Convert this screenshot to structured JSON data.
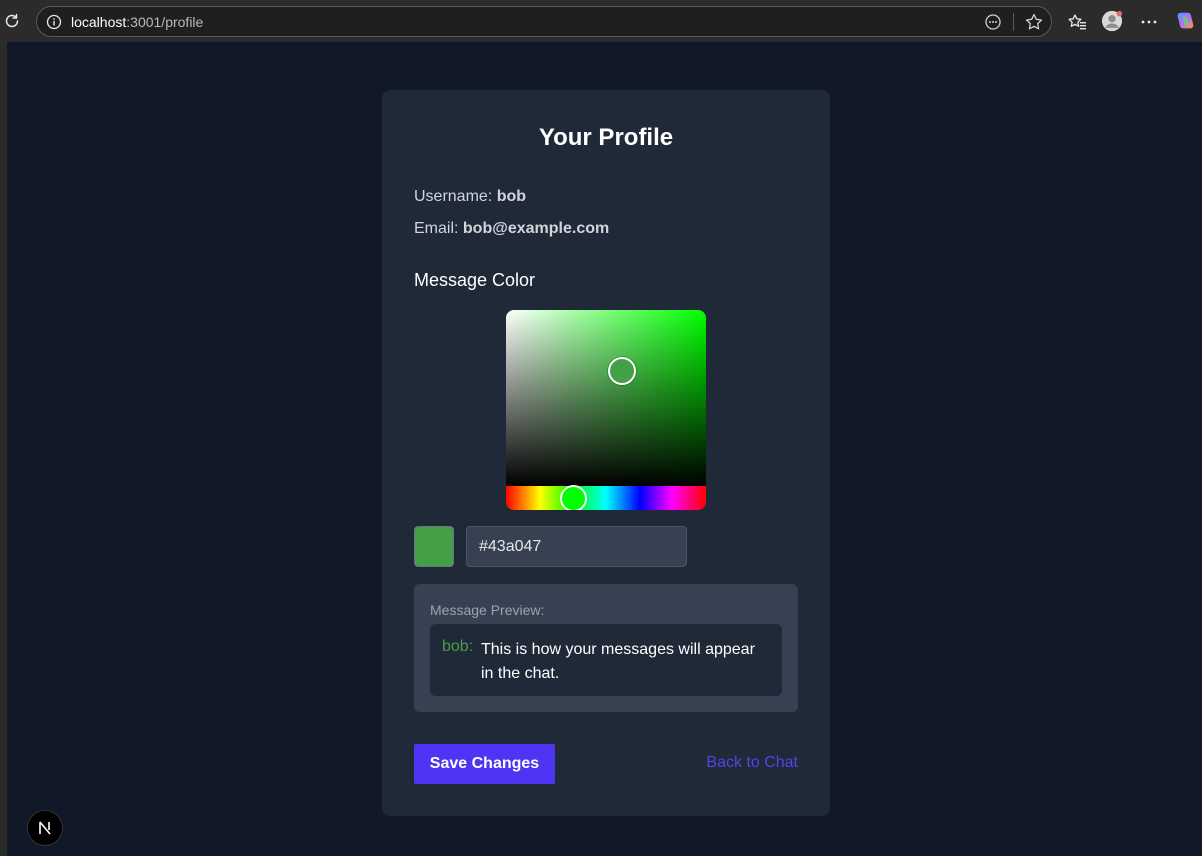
{
  "browser": {
    "url_host": "localhost",
    "url_path": ":3001/profile"
  },
  "profile": {
    "title": "Your Profile",
    "username_label": "Username:",
    "username": "bob",
    "email_label": "Email:",
    "email": "bob@example.com"
  },
  "color": {
    "heading": "Message Color",
    "selected_hex": "#43a047",
    "hue_fraction": 0.33,
    "saturation_fraction": 0.55,
    "value_fraction": 0.63
  },
  "preview": {
    "label": "Message Preview:",
    "username": "bob:",
    "text": "This is how your messages will appear in the chat."
  },
  "actions": {
    "save_label": "Save Changes",
    "back_label": "Back to Chat"
  },
  "colors": {
    "page_bg": "#111827",
    "card_bg": "#1f2937",
    "accent": "#4f35f3",
    "link": "#4f46e5"
  },
  "icons": {
    "reload": "reload-icon",
    "site_info": "info-icon",
    "reader": "reader-mode-icon",
    "favorite": "star-icon",
    "favorites": "favorites-icon",
    "avatar": "avatar",
    "more": "more-icon",
    "copilot": "copilot-icon",
    "next": "nextjs-icon"
  }
}
